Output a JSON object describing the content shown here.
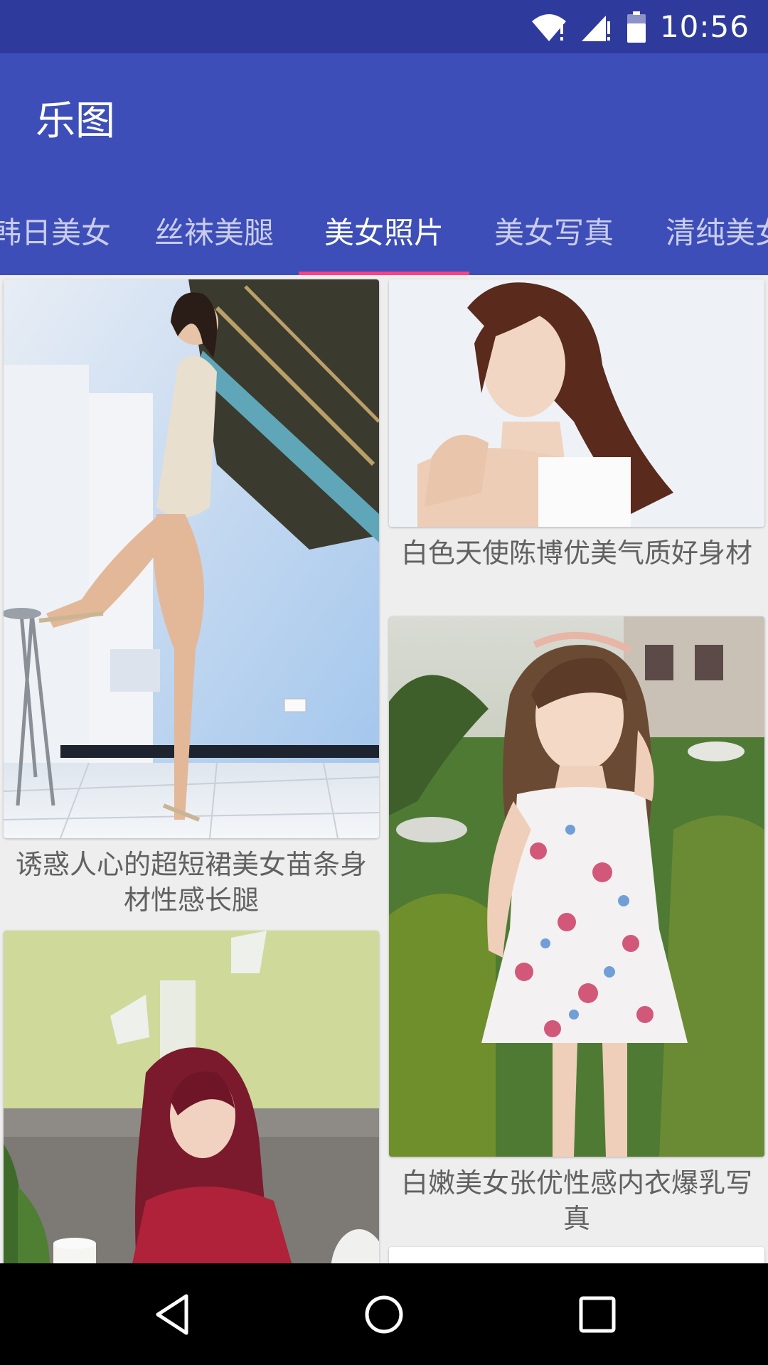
{
  "status_bar": {
    "time": "10:56",
    "icons": [
      "wifi-icon",
      "signal-icon",
      "battery-icon"
    ]
  },
  "app_bar": {
    "title": "乐图"
  },
  "tabs": [
    {
      "label": "韩日美女"
    },
    {
      "label": "丝袜美腿"
    },
    {
      "label": "美女照片",
      "active": true
    },
    {
      "label": "美女写真"
    },
    {
      "label": "清纯美女"
    }
  ],
  "cards": [
    {
      "caption": "诱惑人心的超短裙美女苗条身材性感长腿"
    },
    {
      "caption": "白色天使陈博优美气质好身材"
    },
    {
      "caption": "白嫩美女张优性感内衣爆乳写真"
    },
    {
      "caption": ""
    }
  ],
  "colors": {
    "status_bar": "#2f3b9c",
    "app_bar": "#3d4eb8",
    "tab_indicator": "#ff4081",
    "background": "#eeeeee"
  },
  "nav_bar": {
    "icons": [
      "back-icon",
      "home-icon",
      "recents-icon"
    ]
  }
}
